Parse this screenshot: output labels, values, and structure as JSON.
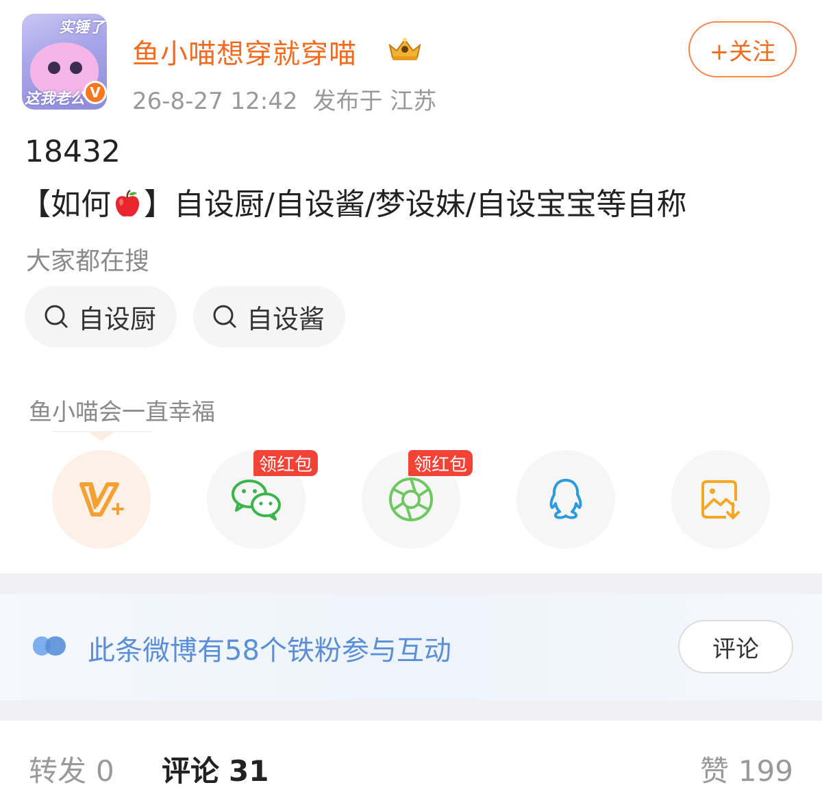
{
  "header": {
    "avatar": {
      "text_top": "实锤了",
      "text_bottom": "这我老公"
    },
    "verified_badge": "V",
    "username": "鱼小喵想穿就穿喵",
    "timestamp": "26-8-27 12:42",
    "location": "发布于 江苏",
    "follow_label": "+关注"
  },
  "post": {
    "line1": "18432",
    "line2_before": "【如何",
    "line2_after": "】自设厨/自设酱/梦设妹/自设宝宝等自称"
  },
  "search": {
    "title": "大家都在搜",
    "chips": [
      {
        "label": "自设厨"
      },
      {
        "label": "自设酱"
      }
    ]
  },
  "slogan": "鱼小喵会一直幸福",
  "share": {
    "redpacket_label": "领红包",
    "items": [
      {
        "icon": "vip-plus-icon"
      },
      {
        "icon": "wechat-icon"
      },
      {
        "icon": "moments-icon"
      },
      {
        "icon": "qq-icon"
      },
      {
        "icon": "save-image-icon"
      }
    ]
  },
  "fans_banner": {
    "text": "此条微博有58个铁粉参与互动",
    "button_label": "评论"
  },
  "tabs": {
    "repost": {
      "label": "转发",
      "count": "0"
    },
    "comment": {
      "label": "评论",
      "count": "31"
    },
    "like": {
      "label": "赞",
      "count": "199"
    }
  },
  "colors": {
    "accent_orange": "#f36b1f",
    "fans_blue": "#5a8fd8",
    "redpacket_red": "#f34236",
    "wechat_green": "#39b54a",
    "qq_blue": "#2b9bdb",
    "save_orange": "#f5a623"
  }
}
